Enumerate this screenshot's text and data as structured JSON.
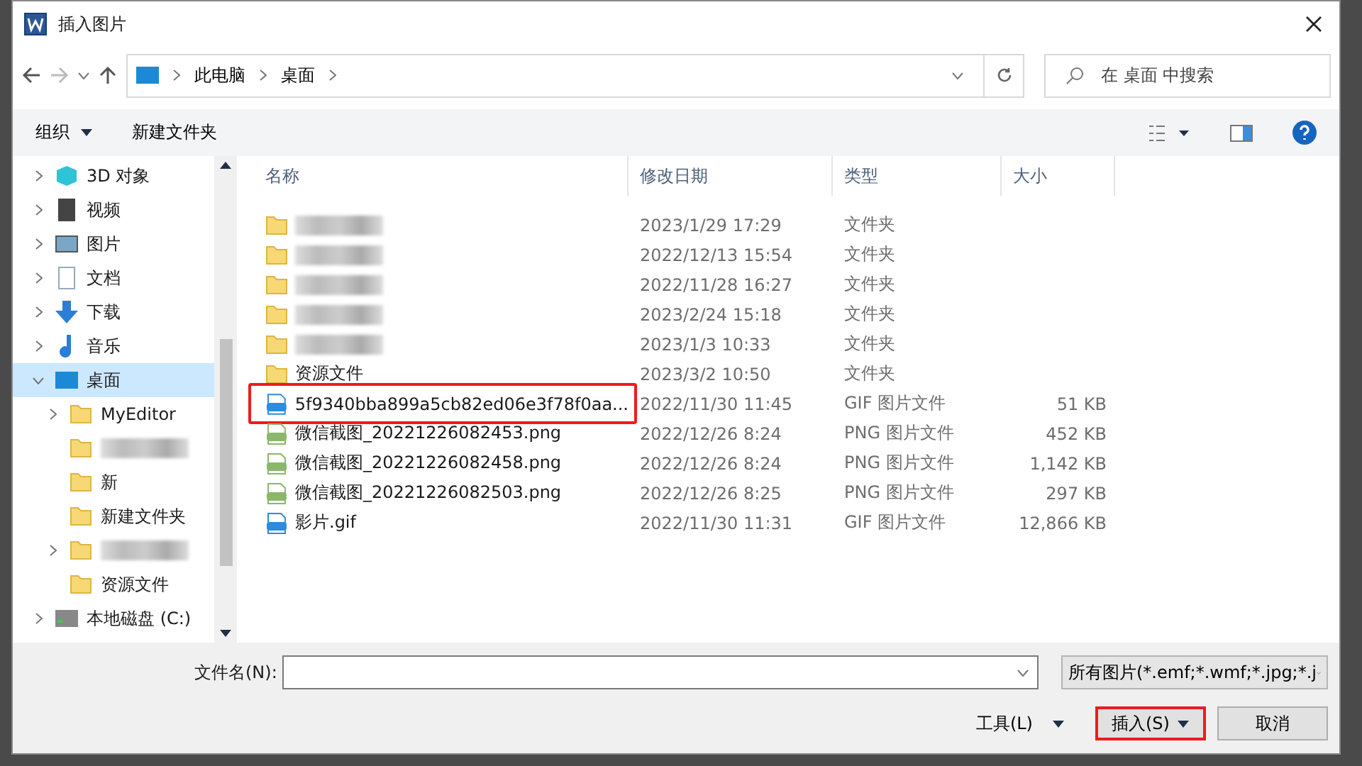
{
  "window": {
    "title": "插入图片"
  },
  "address": {
    "path": [
      "此电脑",
      "桌面"
    ]
  },
  "search": {
    "placeholder": "在 桌面 中搜索"
  },
  "toolbar": {
    "organize": "组织",
    "new_folder": "新建文件夹"
  },
  "sidebar": {
    "items": [
      {
        "label": "3D 对象",
        "kind": "cube",
        "expanded": false,
        "selected": false
      },
      {
        "label": "视频",
        "kind": "film",
        "expanded": false,
        "selected": false
      },
      {
        "label": "图片",
        "kind": "picture",
        "expanded": false,
        "selected": false
      },
      {
        "label": "文档",
        "kind": "document",
        "expanded": false,
        "selected": false
      },
      {
        "label": "下载",
        "kind": "download",
        "expanded": false,
        "selected": false
      },
      {
        "label": "音乐",
        "kind": "music",
        "expanded": false,
        "selected": false
      },
      {
        "label": "桌面",
        "kind": "desktop",
        "expanded": true,
        "selected": true,
        "children": [
          {
            "label": "MyEditor",
            "has_children": true,
            "selected": false
          },
          {
            "has_children": false,
            "selected": false
          },
          {
            "label": "新",
            "has_children": false,
            "selected": false
          },
          {
            "label": "新建文件夹",
            "has_children": false,
            "selected": false
          },
          {
            "has_children": true,
            "selected": false
          },
          {
            "label": "资源文件",
            "has_children": false,
            "selected": false
          }
        ]
      },
      {
        "label": "本地磁盘 (C:)",
        "kind": "drive",
        "expanded": false,
        "selected": false
      }
    ]
  },
  "table": {
    "columns": [
      "名称",
      "修改日期",
      "类型",
      "大小"
    ],
    "rows": [
      {
        "kind": "folder",
        "date": "2023/1/29 17:29",
        "type": "文件夹",
        "highlighted": false
      },
      {
        "kind": "folder",
        "date": "2022/12/13 15:54",
        "type": "文件夹",
        "highlighted": false
      },
      {
        "kind": "folder",
        "date": "2022/11/28 16:27",
        "type": "文件夹",
        "highlighted": false
      },
      {
        "kind": "folder",
        "date": "2023/2/24 15:18",
        "type": "文件夹",
        "highlighted": false
      },
      {
        "kind": "folder",
        "date": "2023/1/3 10:33",
        "type": "文件夹",
        "highlighted": false
      },
      {
        "kind": "folder",
        "name": "资源文件",
        "date": "2023/3/2 10:50",
        "type": "文件夹",
        "highlighted": false
      },
      {
        "kind": "gif",
        "name": "5f9340bba899a5cb82ed06e3f78f0aa...",
        "date": "2022/11/30 11:45",
        "type": "GIF 图片文件",
        "size": "51 KB",
        "highlighted": true
      },
      {
        "kind": "png",
        "name": "微信截图_20221226082453.png",
        "date": "2022/12/26 8:24",
        "type": "PNG 图片文件",
        "size": "452 KB",
        "highlighted": false
      },
      {
        "kind": "png",
        "name": "微信截图_20221226082458.png",
        "date": "2022/12/26 8:24",
        "type": "PNG 图片文件",
        "size": "1,142 KB",
        "highlighted": false
      },
      {
        "kind": "png",
        "name": "微信截图_20221226082503.png",
        "date": "2022/12/26 8:25",
        "type": "PNG 图片文件",
        "size": "297 KB",
        "highlighted": false
      },
      {
        "kind": "gif",
        "name": "影片.gif",
        "date": "2022/11/30 11:31",
        "type": "GIF 图片文件",
        "size": "12,866 KB",
        "highlighted": false
      }
    ]
  },
  "footer": {
    "filename_label": "文件名(N):",
    "filter": "所有图片(*.emf;*.wmf;*.jpg;*.j",
    "tools": "工具(L)",
    "insert": {
      "label": "插入(S)",
      "highlighted": true
    },
    "cancel": "取消"
  }
}
